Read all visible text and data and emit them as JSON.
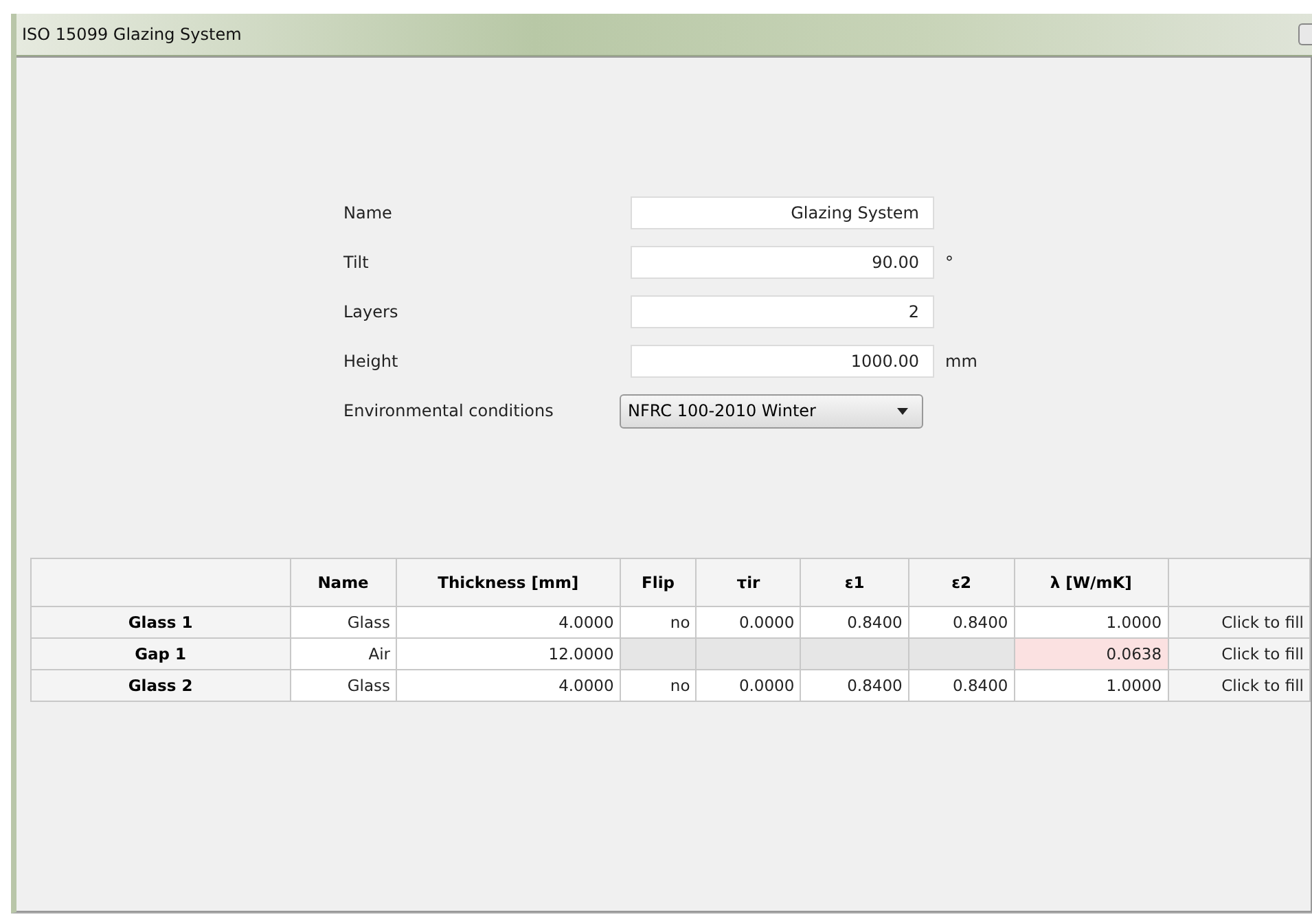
{
  "window": {
    "title": "ISO 15099 Glazing System"
  },
  "form": [
    {
      "label": "Name",
      "kind": "text",
      "value": "Glazing System"
    },
    {
      "label": "Tilt",
      "kind": "text",
      "value": "90.00",
      "unit": "°"
    },
    {
      "label": "Layers",
      "kind": "text",
      "value": "2"
    },
    {
      "label": "Height",
      "kind": "text",
      "value": "1000.00",
      "unit": "mm"
    },
    {
      "label": "Environmental conditions",
      "kind": "dropdown",
      "value": "NFRC 100-2010 Winter"
    }
  ],
  "table": {
    "columns": [
      "Name",
      "Thickness [mm]",
      "Flip",
      "τir",
      "ε1",
      "ε2",
      "λ [W/mK]"
    ],
    "rows": [
      {
        "header": "Glass 1",
        "cells": [
          {
            "text": "Glass"
          },
          {
            "text": "4.0000"
          },
          {
            "text": "no"
          },
          {
            "text": "0.0000"
          },
          {
            "text": "0.8400"
          },
          {
            "text": "0.8400"
          },
          {
            "text": "1.0000"
          }
        ],
        "action": "Click to fill"
      },
      {
        "header": "Gap 1",
        "cells": [
          {
            "text": "Air"
          },
          {
            "text": "12.0000"
          },
          {
            "disabled": true
          },
          {
            "disabled": true
          },
          {
            "disabled": true
          },
          {
            "disabled": true
          },
          {
            "text": "0.0638",
            "highlighted": true
          }
        ],
        "action": "Click to fill"
      },
      {
        "header": "Glass 2",
        "cells": [
          {
            "text": "Glass"
          },
          {
            "text": "4.0000"
          },
          {
            "text": "no"
          },
          {
            "text": "0.0000"
          },
          {
            "text": "0.8400"
          },
          {
            "text": "0.8400"
          },
          {
            "text": "1.0000"
          }
        ],
        "action": "Click to fill"
      }
    ]
  }
}
